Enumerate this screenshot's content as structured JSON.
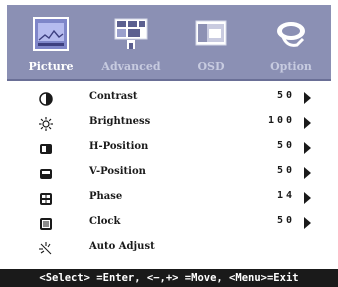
{
  "tabs": [
    {
      "label": "Picture",
      "icon": "picture-icon",
      "active": true
    },
    {
      "label": "Advanced",
      "icon": "advanced-icon",
      "active": false
    },
    {
      "label": "OSD",
      "icon": "osd-icon",
      "active": false
    },
    {
      "label": "Option",
      "icon": "option-icon",
      "active": false
    }
  ],
  "rows": [
    {
      "label": "Contrast",
      "value": "50",
      "icon": "contrast-icon",
      "has_arrow": true
    },
    {
      "label": "Brightness",
      "value": "100",
      "icon": "brightness-icon",
      "has_arrow": true
    },
    {
      "label": "H-Position",
      "value": "50",
      "icon": "h-position-icon",
      "has_arrow": true
    },
    {
      "label": "V-Position",
      "value": "50",
      "icon": "v-position-icon",
      "has_arrow": true
    },
    {
      "label": "Phase",
      "value": "14",
      "icon": "phase-icon",
      "has_arrow": true
    },
    {
      "label": "Clock",
      "value": "50",
      "icon": "clock-icon",
      "has_arrow": true
    },
    {
      "label": "Auto Adjust",
      "value": "",
      "icon": "auto-adjust-icon",
      "has_arrow": false
    }
  ],
  "help": "<Select> =Enter, <−,+> =Move, <Menu>=Exit",
  "colors": {
    "tabbar": "#8b90b4",
    "helpbar": "#1a1a1a",
    "text": "#1a1a1a"
  }
}
